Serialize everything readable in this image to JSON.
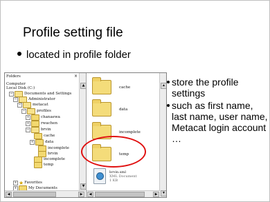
{
  "slide": {
    "title": "Profile setting file",
    "bullet": "located in profile folder"
  },
  "explorer": {
    "tree_header": "Folders",
    "tree_close": "×",
    "tree": [
      {
        "label": "Computer",
        "icon": "computer-icon"
      },
      {
        "label": "Local Disk (C:)",
        "icon": "drive-icon"
      },
      {
        "label": "Documents and Settings",
        "icon": "folder-icon",
        "toggle": "−"
      },
      {
        "label": "Administrator",
        "icon": "folder-icon",
        "toggle": "−"
      },
      {
        "label": "metacat",
        "icon": "folder-icon",
        "toggle": "−"
      },
      {
        "label": "profiles",
        "icon": "folder-icon",
        "toggle": "−"
      },
      {
        "label": "chanaewa",
        "icon": "folder-icon",
        "toggle": "+"
      },
      {
        "label": "rwachen",
        "icon": "folder-icon",
        "toggle": "+"
      },
      {
        "label": "brvin",
        "icon": "folder-icon",
        "toggle": "−"
      },
      {
        "label": "cache",
        "icon": "folder-icon"
      },
      {
        "label": "data",
        "icon": "folder-icon",
        "toggle": "+"
      },
      {
        "label": "incomplete",
        "icon": "folder-icon"
      },
      {
        "label": "brvin",
        "icon": "folder-icon"
      },
      {
        "label": "incomplete",
        "icon": "folder-icon"
      },
      {
        "label": "temp",
        "icon": "folder-icon"
      },
      {
        "label": "Favorites",
        "icon": "star-icon",
        "toggle": "+"
      },
      {
        "label": "My Documents",
        "icon": "folder-icon",
        "toggle": "+"
      }
    ],
    "files": [
      {
        "label": "cache"
      },
      {
        "label": "data"
      },
      {
        "label": "incomplete"
      },
      {
        "label": "temp"
      }
    ],
    "xml_file": {
      "name": "brvin.xml",
      "type": "XML Document",
      "size": "1 KB"
    }
  },
  "notes": [
    "store the profile settings",
    "such as first name, last name, user name, Metacat login account …"
  ],
  "colors": {
    "highlight_ring": "#e01010",
    "folder": "#f4dc7a"
  }
}
